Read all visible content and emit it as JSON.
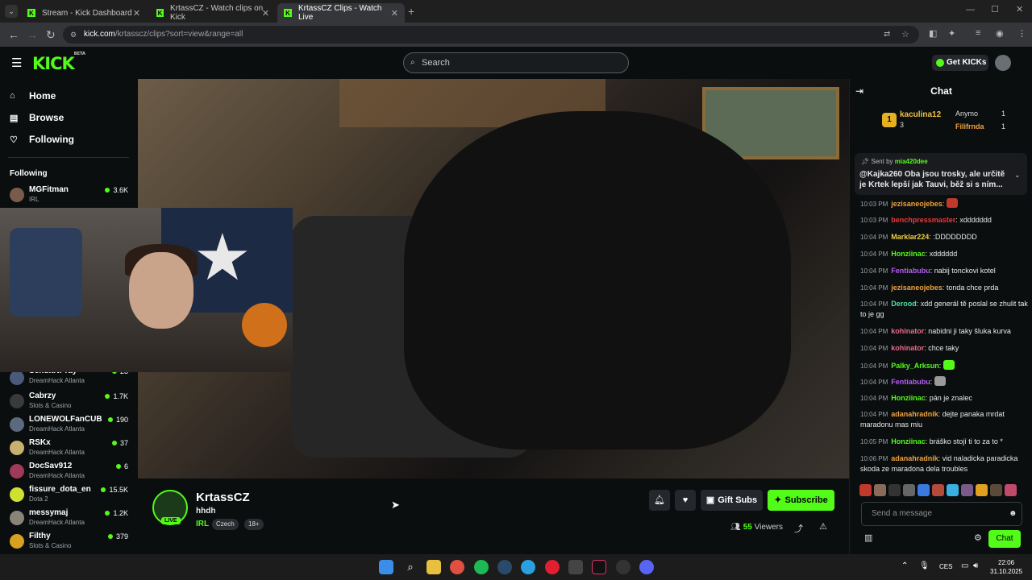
{
  "browser": {
    "tabs": [
      {
        "label": "Stream - Kick Dashboard"
      },
      {
        "label": "KrtassCZ - Watch clips on Kick"
      },
      {
        "label": "KrtassCZ Clips - Watch Live"
      }
    ],
    "url_host": "kick.com",
    "url_path": "/krtasscz/clips?sort=view&range=all"
  },
  "header": {
    "logo": "KICK",
    "logo_beta": "BETA",
    "search_placeholder": "Search",
    "get_kicks": "Get KICKs"
  },
  "sidebar": {
    "nav": [
      {
        "label": "Home",
        "icon": "home-icon"
      },
      {
        "label": "Browse",
        "icon": "browse-icon"
      },
      {
        "label": "Following",
        "icon": "heart-icon"
      }
    ],
    "following_title": "Following",
    "channels": [
      {
        "name": "MGFitman",
        "category": "IRL",
        "viewers": "3.6K"
      },
      {
        "name": "SendItNPray",
        "category": "DreamHack Atlanta",
        "viewers": "28"
      },
      {
        "name": "Cabrzy",
        "category": "Slots & Casino",
        "viewers": "1.7K"
      },
      {
        "name": "LONEWOLFanCUB",
        "category": "DreamHack Atlanta",
        "viewers": "190"
      },
      {
        "name": "RSKx",
        "category": "DreamHack Atlanta",
        "viewers": "37"
      },
      {
        "name": "DocSav912",
        "category": "DreamHack Atlanta",
        "viewers": "6"
      },
      {
        "name": "fissure_dota_en",
        "category": "Dota 2",
        "viewers": "15.5K"
      },
      {
        "name": "messymaj",
        "category": "DreamHack Atlanta",
        "viewers": "1.2K"
      },
      {
        "name": "Filthy",
        "category": "Slots & Casino",
        "viewers": "379"
      }
    ]
  },
  "stream": {
    "channel_name": "KrtassCZ",
    "title": "hhdh",
    "category": "IRL",
    "tags": [
      "Czech",
      "18+"
    ],
    "live_label": "LIVE",
    "gift_subs": "Gift Subs",
    "subscribe": "Subscribe",
    "viewers_count": "55",
    "viewers_label": "Viewers"
  },
  "chat": {
    "title": "Chat",
    "leaderboard": [
      {
        "name": "kaculina12",
        "count": "3"
      },
      {
        "name": "Anymo",
        "count": "1"
      },
      {
        "name": "Filifrnda",
        "count": "1"
      }
    ],
    "pinned_sent_by": "Sent by",
    "pinned_user": "mia420dee",
    "pinned_message": "@Kajka260 Oba jsou trosky, ale určitě je Krtek lepší jak Tauvi, běž si s ním...",
    "messages": [
      {
        "time": "10:03 PM",
        "user": "jezisaneojebes",
        "color": "#f0a23c",
        "text": ""
      },
      {
        "time": "10:03 PM",
        "user": "benchpressmaster",
        "color": "#e83a3a",
        "text": "xddddddd"
      },
      {
        "time": "10:04 PM",
        "user": "Marklar224",
        "color": "#f0d040",
        "text": ":DDDDDDDD"
      },
      {
        "time": "10:04 PM",
        "user": "Honziinac",
        "color": "#53fc18",
        "text": "xdddddd"
      },
      {
        "time": "10:04 PM",
        "user": "Fentiabubu",
        "color": "#b45cf5",
        "text": "nabij tonckovi kotel"
      },
      {
        "time": "10:04 PM",
        "user": "jezisaneojebes",
        "color": "#f0a23c",
        "text": "tonda chce prda"
      },
      {
        "time": "10:04 PM",
        "user": "Derood",
        "color": "#4ee0a0",
        "text": "xdd generál tě poslal se zhulit tak to je gg"
      },
      {
        "time": "10:04 PM",
        "user": "kohinator",
        "color": "#e86a8a",
        "text": "nabidni ji taky šluka kurva"
      },
      {
        "time": "10:04 PM",
        "user": "kohinator",
        "color": "#e86a8a",
        "text": "chce taky"
      },
      {
        "time": "10:04 PM",
        "user": "Palky_Arksun",
        "color": "#53fc18",
        "text": ""
      },
      {
        "time": "10:04 PM",
        "user": "Fentiabubu",
        "color": "#b45cf5",
        "text": ""
      },
      {
        "time": "10:04 PM",
        "user": "Honziinac",
        "color": "#53fc18",
        "text": "pán je znalec"
      },
      {
        "time": "10:04 PM",
        "user": "adanahradnik",
        "color": "#f0a23c",
        "text": "dejte panaka mrdat maradonu mas miu"
      },
      {
        "time": "10:05 PM",
        "user": "Honziinac",
        "color": "#53fc18",
        "text": "bráško stojí ti to za to *"
      },
      {
        "time": "10:06 PM",
        "user": "adanahradnik",
        "color": "#f0a23c",
        "text": "vid naladicka paradicka skoda ze maradona dela troubles"
      }
    ],
    "input_placeholder": "Send a message",
    "chat_button": "Chat"
  },
  "taskbar": {
    "language": "CES",
    "time": "22:06",
    "date": "31.10.2025"
  },
  "colors": {
    "brand": "#53fc18",
    "background": "#0b0e0f"
  }
}
